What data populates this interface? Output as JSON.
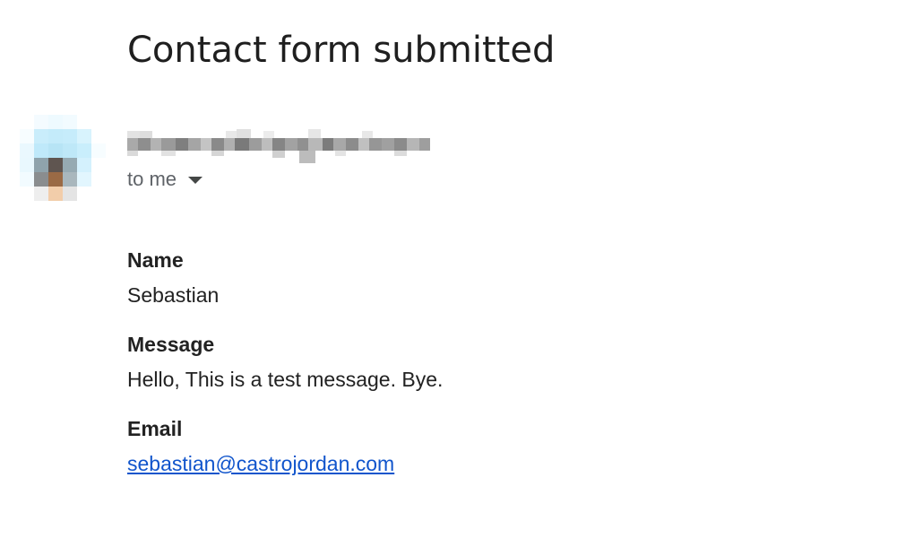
{
  "email": {
    "subject": "Contact form submitted",
    "recipients_label": "to me",
    "sender_redacted": true,
    "fields": [
      {
        "label": "Name",
        "value": "Sebastian",
        "is_link": false
      },
      {
        "label": "Message",
        "value": "Hello, This is a test message. Bye.",
        "is_link": false
      },
      {
        "label": "Email",
        "value": "sebastian@castrojordan.com",
        "is_link": true
      }
    ]
  },
  "colors": {
    "text": "#222222",
    "muted": "#5f6368",
    "link": "#1155cc",
    "background": "#ffffff"
  },
  "icons": {
    "recipients_toggle": "caret-down-icon",
    "avatar": "pixelated-avatar"
  }
}
